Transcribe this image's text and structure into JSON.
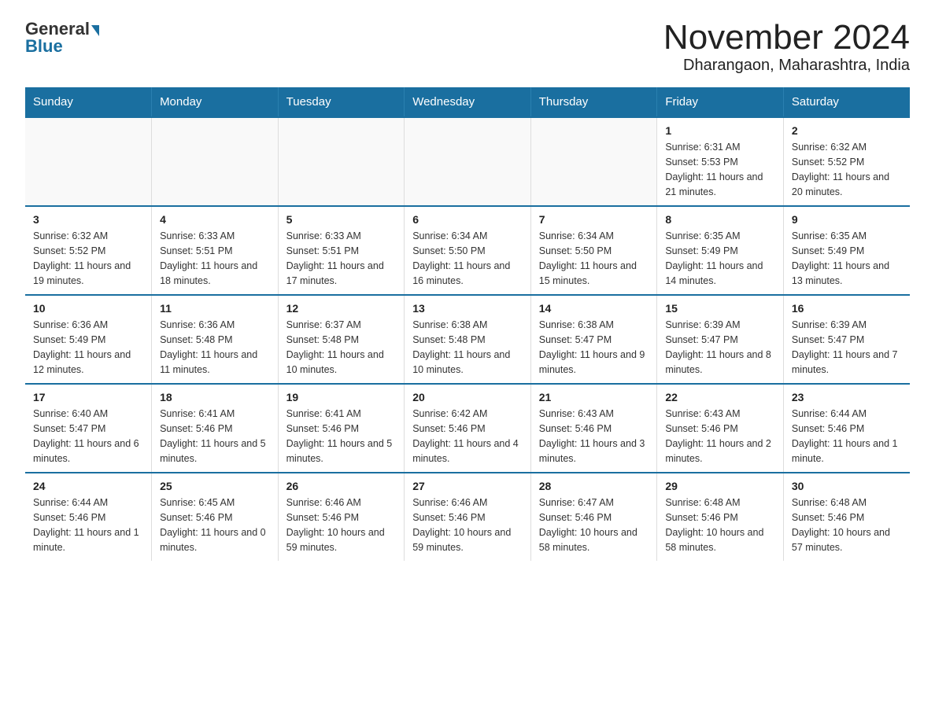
{
  "logo": {
    "general": "General",
    "blue": "Blue"
  },
  "title": "November 2024",
  "subtitle": "Dharangaon, Maharashtra, India",
  "days_of_week": [
    "Sunday",
    "Monday",
    "Tuesday",
    "Wednesday",
    "Thursday",
    "Friday",
    "Saturday"
  ],
  "weeks": [
    [
      {
        "day": "",
        "info": ""
      },
      {
        "day": "",
        "info": ""
      },
      {
        "day": "",
        "info": ""
      },
      {
        "day": "",
        "info": ""
      },
      {
        "day": "",
        "info": ""
      },
      {
        "day": "1",
        "info": "Sunrise: 6:31 AM\nSunset: 5:53 PM\nDaylight: 11 hours and 21 minutes."
      },
      {
        "day": "2",
        "info": "Sunrise: 6:32 AM\nSunset: 5:52 PM\nDaylight: 11 hours and 20 minutes."
      }
    ],
    [
      {
        "day": "3",
        "info": "Sunrise: 6:32 AM\nSunset: 5:52 PM\nDaylight: 11 hours and 19 minutes."
      },
      {
        "day": "4",
        "info": "Sunrise: 6:33 AM\nSunset: 5:51 PM\nDaylight: 11 hours and 18 minutes."
      },
      {
        "day": "5",
        "info": "Sunrise: 6:33 AM\nSunset: 5:51 PM\nDaylight: 11 hours and 17 minutes."
      },
      {
        "day": "6",
        "info": "Sunrise: 6:34 AM\nSunset: 5:50 PM\nDaylight: 11 hours and 16 minutes."
      },
      {
        "day": "7",
        "info": "Sunrise: 6:34 AM\nSunset: 5:50 PM\nDaylight: 11 hours and 15 minutes."
      },
      {
        "day": "8",
        "info": "Sunrise: 6:35 AM\nSunset: 5:49 PM\nDaylight: 11 hours and 14 minutes."
      },
      {
        "day": "9",
        "info": "Sunrise: 6:35 AM\nSunset: 5:49 PM\nDaylight: 11 hours and 13 minutes."
      }
    ],
    [
      {
        "day": "10",
        "info": "Sunrise: 6:36 AM\nSunset: 5:49 PM\nDaylight: 11 hours and 12 minutes."
      },
      {
        "day": "11",
        "info": "Sunrise: 6:36 AM\nSunset: 5:48 PM\nDaylight: 11 hours and 11 minutes."
      },
      {
        "day": "12",
        "info": "Sunrise: 6:37 AM\nSunset: 5:48 PM\nDaylight: 11 hours and 10 minutes."
      },
      {
        "day": "13",
        "info": "Sunrise: 6:38 AM\nSunset: 5:48 PM\nDaylight: 11 hours and 10 minutes."
      },
      {
        "day": "14",
        "info": "Sunrise: 6:38 AM\nSunset: 5:47 PM\nDaylight: 11 hours and 9 minutes."
      },
      {
        "day": "15",
        "info": "Sunrise: 6:39 AM\nSunset: 5:47 PM\nDaylight: 11 hours and 8 minutes."
      },
      {
        "day": "16",
        "info": "Sunrise: 6:39 AM\nSunset: 5:47 PM\nDaylight: 11 hours and 7 minutes."
      }
    ],
    [
      {
        "day": "17",
        "info": "Sunrise: 6:40 AM\nSunset: 5:47 PM\nDaylight: 11 hours and 6 minutes."
      },
      {
        "day": "18",
        "info": "Sunrise: 6:41 AM\nSunset: 5:46 PM\nDaylight: 11 hours and 5 minutes."
      },
      {
        "day": "19",
        "info": "Sunrise: 6:41 AM\nSunset: 5:46 PM\nDaylight: 11 hours and 5 minutes."
      },
      {
        "day": "20",
        "info": "Sunrise: 6:42 AM\nSunset: 5:46 PM\nDaylight: 11 hours and 4 minutes."
      },
      {
        "day": "21",
        "info": "Sunrise: 6:43 AM\nSunset: 5:46 PM\nDaylight: 11 hours and 3 minutes."
      },
      {
        "day": "22",
        "info": "Sunrise: 6:43 AM\nSunset: 5:46 PM\nDaylight: 11 hours and 2 minutes."
      },
      {
        "day": "23",
        "info": "Sunrise: 6:44 AM\nSunset: 5:46 PM\nDaylight: 11 hours and 1 minute."
      }
    ],
    [
      {
        "day": "24",
        "info": "Sunrise: 6:44 AM\nSunset: 5:46 PM\nDaylight: 11 hours and 1 minute."
      },
      {
        "day": "25",
        "info": "Sunrise: 6:45 AM\nSunset: 5:46 PM\nDaylight: 11 hours and 0 minutes."
      },
      {
        "day": "26",
        "info": "Sunrise: 6:46 AM\nSunset: 5:46 PM\nDaylight: 10 hours and 59 minutes."
      },
      {
        "day": "27",
        "info": "Sunrise: 6:46 AM\nSunset: 5:46 PM\nDaylight: 10 hours and 59 minutes."
      },
      {
        "day": "28",
        "info": "Sunrise: 6:47 AM\nSunset: 5:46 PM\nDaylight: 10 hours and 58 minutes."
      },
      {
        "day": "29",
        "info": "Sunrise: 6:48 AM\nSunset: 5:46 PM\nDaylight: 10 hours and 58 minutes."
      },
      {
        "day": "30",
        "info": "Sunrise: 6:48 AM\nSunset: 5:46 PM\nDaylight: 10 hours and 57 minutes."
      }
    ]
  ]
}
